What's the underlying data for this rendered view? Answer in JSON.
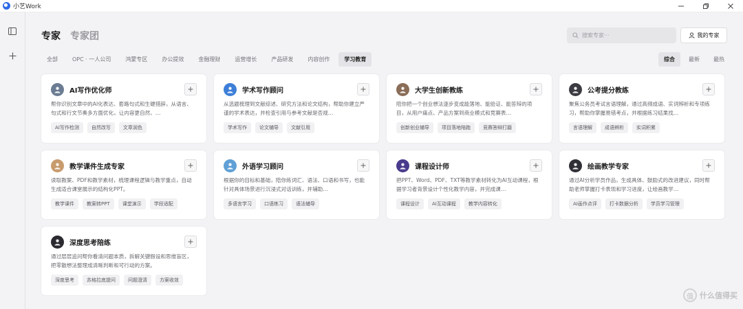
{
  "window": {
    "title": "小艺Work"
  },
  "heading": {
    "active": "专家",
    "inactive": "专家团"
  },
  "search": {
    "placeholder": "搜索专家···"
  },
  "my_expert": {
    "label": "我的专家"
  },
  "categories": [
    "全部",
    "OPC · 一人公司",
    "鸿蒙专区",
    "办公提效",
    "金融理财",
    "运营增长",
    "产品研发",
    "内容创作",
    "学习教育"
  ],
  "active_category": "学习教育",
  "sorts": [
    "综合",
    "最新",
    "最热"
  ],
  "active_sort": "综合",
  "cards": [
    {
      "title": "AI写作优化师",
      "icon": "pen-avatar-icon",
      "color": "#6b7c93",
      "desc": "帮你识别文章中的AI化表达、套路句式和生硬措辞，从语言、句式和行文节奏多方面优化，让内容更自然、…",
      "tags": [
        "AI写作检测",
        "自然改写",
        "文章润色"
      ]
    },
    {
      "title": "学术写作顾问",
      "icon": "academic-avatar-icon",
      "color": "#3d7fd8",
      "desc": "从选题梳理到文献综述、研究方法和论文结构，帮助你建立严谨的学术表达，并检查引用与参考文献是否规…",
      "tags": [
        "学术写作",
        "论文辅导",
        "文献引用"
      ]
    },
    {
      "title": "大学生创新教练",
      "icon": "coach-avatar-icon",
      "color": "#8a6d58",
      "desc": "陪你把一个创业想法逐步变成能落地、能验证、能答辩的项目，从用户痛点、产品方案到商业模式和竞赛表…",
      "tags": [
        "创新创业辅导",
        "项目落地陪跑",
        "竞赛答辩打磨"
      ]
    },
    {
      "title": "公考提分教练",
      "icon": "exam-avatar-icon",
      "color": "#3b3b42",
      "desc": "聚焦公务员考试言语理解，通过高频成语、实词辨析和专项练习，帮助你掌握易错考点，并根据练习结果找…",
      "tags": [
        "言语理解",
        "成语辨析",
        "实词积累"
      ]
    },
    {
      "title": "教学课件生成专家",
      "icon": "courseware-avatar-icon",
      "color": "#c89b6d",
      "desc": "读取教案、PDF和教学素材，梳理课程逻辑与教学重点，自动生成适合课堂展示的结构化PPT。",
      "tags": [
        "教学课件",
        "教案转PPT",
        "课堂演示",
        "学段适配"
      ]
    },
    {
      "title": "外语学习顾问",
      "icon": "language-avatar-icon",
      "color": "#5fa0d6",
      "desc": "根据你的目标和基础，陪你练词汇、语法、口语和书写，也能针对具体场景进行沉浸式对话训练，并辅助…",
      "tags": [
        "多语言学习",
        "口语练习",
        "语法辅导"
      ]
    },
    {
      "title": "课程设计师",
      "icon": "course-design-avatar-icon",
      "color": "#4a3a8c",
      "desc": "把PPT、Word、PDF、TXT等教学素材转化为AI互动课程，根据学习者背景设计个性化教学内容，并完成课…",
      "tags": [
        "课程设计",
        "AI互动课程",
        "教学内容转化"
      ]
    },
    {
      "title": "绘画教学专家",
      "icon": "painting-avatar-icon",
      "color": "#2f2f36",
      "desc": "通过AI分析学员作品，生成具体、鼓励式的改进建议，同时帮助老师掌握打卡表现和学习进度，让绘画教学…",
      "tags": [
        "AI画作点评",
        "打卡数据分析",
        "学员学习管理"
      ]
    },
    {
      "title": "深度思考陪练",
      "icon": "thinking-avatar-icon",
      "color": "#2a2a30",
      "desc": "通过层层追问帮你看清问题本质，拆解关键假设和思维盲区，把零散想法整理成清晰判断和可行动的方案。",
      "tags": [
        "深度思考",
        "苏格拉底提问",
        "问题澄清",
        "方案收敛"
      ]
    }
  ],
  "watermark": {
    "text": "什么值得买"
  }
}
